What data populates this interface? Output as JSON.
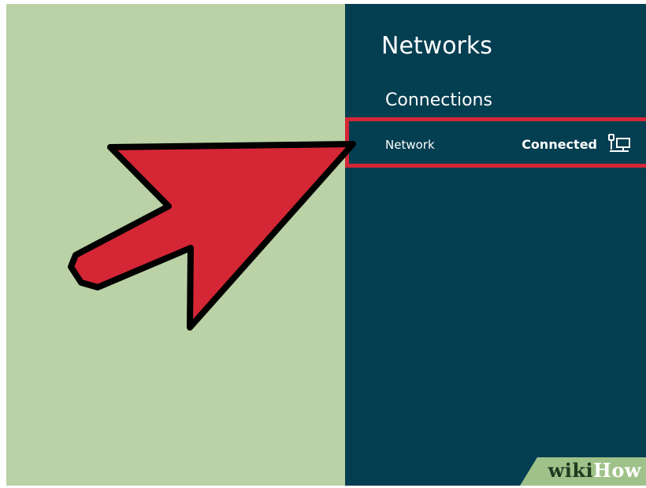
{
  "panel": {
    "title": "Networks",
    "section_label": "Connections",
    "network": {
      "name": "Network",
      "status": "Connected",
      "icon": "wired-network-icon"
    }
  },
  "annotation": {
    "arrow_color": "#d52636",
    "highlight_color": "#d52636"
  },
  "watermark": {
    "part1": "wiki",
    "part2": "How"
  },
  "colors": {
    "left_background": "#bad2a5",
    "panel_background": "#043e51"
  }
}
